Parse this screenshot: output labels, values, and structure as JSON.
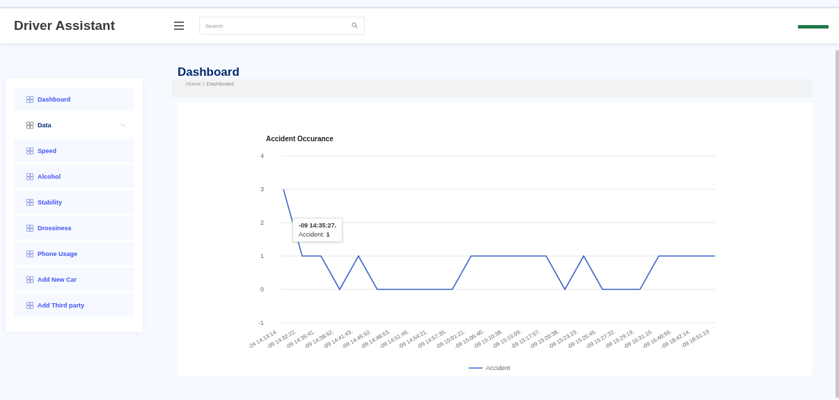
{
  "header": {
    "title": "Driver Assistant",
    "search": {
      "placeholder": "Search"
    }
  },
  "sidebar": {
    "items": [
      {
        "label": "Dashboard",
        "kind": "link"
      },
      {
        "label": "Data",
        "kind": "dropdown"
      },
      {
        "label": "Speed",
        "kind": "link"
      },
      {
        "label": "Alcohol",
        "kind": "link"
      },
      {
        "label": "Stability",
        "kind": "link"
      },
      {
        "label": "Drossiness",
        "kind": "link"
      },
      {
        "label": "Phone Usage",
        "kind": "link"
      },
      {
        "label": "Add New Car",
        "kind": "link"
      },
      {
        "label": "Add Third party",
        "kind": "link"
      }
    ]
  },
  "page": {
    "title": "Dashboard",
    "breadcrumb": [
      "Home",
      "Dashboard"
    ],
    "breadcrumb_separator": "/"
  },
  "card": {
    "tooltip": {
      "title": "-09 14:35:27.",
      "body": "Accident: **1**"
    },
    "chart_data": {
      "type": "line",
      "title": "Accident Occurance",
      "ylim": [
        -1,
        4
      ],
      "yticks": [
        -1,
        0,
        1,
        2,
        3,
        4
      ],
      "grid": true,
      "categories": [
        "-24 14:13:14.",
        "-09 14:32:22.",
        "-09 14:35:41.",
        "-09 14:38:52.",
        "-09 14:41:43.",
        "-09 14:45:52.",
        "-09 14:48:53.",
        "-09 14:51:46.",
        "-09 14:54:21.",
        "-09 14:57:35.",
        "-09 15:01:21.",
        "-09 15:05:40.",
        "-09 15:10:38.",
        "-09 15:15:09.",
        "-09 15:17:57.",
        "-09 15:20:38.",
        "-09 15:23:23.",
        "-09 15:25:45.",
        "-09 15:27:32.",
        "-09 15:29:19.",
        "-09 16:31:15.",
        "-09 16:40:55.",
        "-09 18:42:14.",
        "-09 18:51:19"
      ],
      "series": [
        {
          "name": "Accident",
          "color": "#3d66cc",
          "values": [
            3,
            1,
            1,
            0,
            1,
            0,
            0,
            0,
            0,
            0,
            1,
            1,
            1,
            1,
            1,
            0,
            1,
            0,
            0,
            0,
            1,
            1,
            1,
            1
          ]
        }
      ]
    }
  }
}
